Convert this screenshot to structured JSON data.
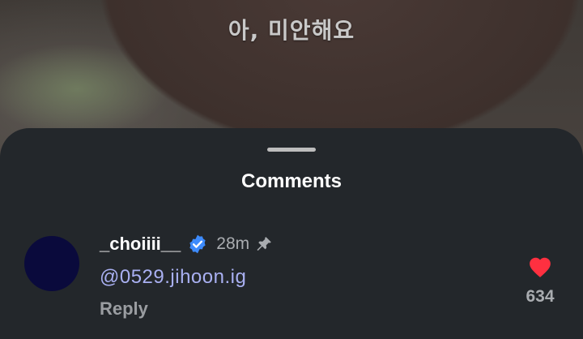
{
  "video": {
    "subtitle": "아, 미안해요"
  },
  "comments_sheet": {
    "title": "Comments",
    "comment": {
      "username": "_choiiii__",
      "verified": true,
      "time": "28m",
      "pinned": true,
      "text": "@0529.jihoon.ig",
      "reply_label": "Reply",
      "like_count": "634",
      "liked": true
    }
  },
  "colors": {
    "sheet_background": "#23272b",
    "mention": "#a9b0f2",
    "verified_badge": "#3d8bfd",
    "heart": "#ff3040",
    "avatar": "#0a0a3c"
  },
  "icons": {
    "verified": "verified-badge-icon",
    "pin": "pin-icon",
    "heart": "heart-icon",
    "handle": "drag-handle"
  }
}
